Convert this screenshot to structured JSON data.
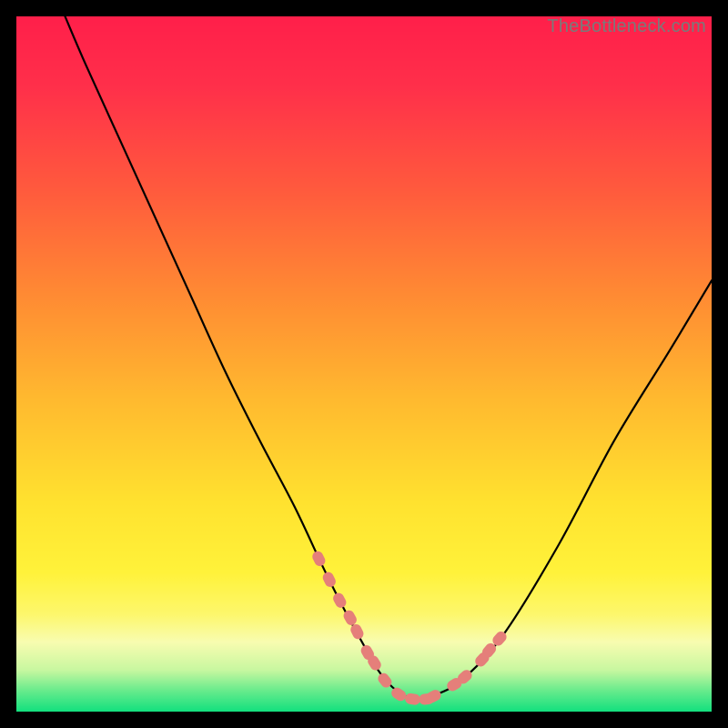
{
  "watermark": "TheBottleneck.com",
  "colors": {
    "frame": "#000000",
    "gradient_stops": [
      {
        "offset": 0.0,
        "color": "#ff1f4a"
      },
      {
        "offset": 0.1,
        "color": "#ff2f4a"
      },
      {
        "offset": 0.25,
        "color": "#ff5a3d"
      },
      {
        "offset": 0.4,
        "color": "#ff8a33"
      },
      {
        "offset": 0.55,
        "color": "#ffb92f"
      },
      {
        "offset": 0.7,
        "color": "#ffe22f"
      },
      {
        "offset": 0.8,
        "color": "#fff23a"
      },
      {
        "offset": 0.86,
        "color": "#fdf76c"
      },
      {
        "offset": 0.9,
        "color": "#f8fcb0"
      },
      {
        "offset": 0.94,
        "color": "#c8f7a0"
      },
      {
        "offset": 0.97,
        "color": "#67eb8c"
      },
      {
        "offset": 1.0,
        "color": "#12e07e"
      }
    ],
    "curve_stroke": "#000000",
    "marker": "#e57f7a"
  },
  "chart_data": {
    "type": "line",
    "title": "",
    "xlabel": "",
    "ylabel": "",
    "xlim": [
      0,
      100
    ],
    "ylim": [
      0,
      100
    ],
    "grid": false,
    "legend": false,
    "series": [
      {
        "name": "bottleneck-curve",
        "x": [
          7,
          10,
          15,
          20,
          25,
          30,
          35,
          40,
          44,
          47,
          50,
          52,
          54,
          56,
          58,
          60,
          64,
          70,
          78,
          86,
          94,
          100
        ],
        "y": [
          100,
          93,
          82,
          71,
          60,
          49,
          39,
          29.5,
          21,
          15,
          9.5,
          6,
          3.6,
          2.2,
          1.7,
          2.3,
          4.5,
          11,
          24,
          39,
          52,
          62
        ]
      }
    ],
    "markers": {
      "name": "curve-highlight-points",
      "shape": "pill",
      "approx_radius_px": 7,
      "x": [
        43.5,
        45.0,
        46.5,
        48.0,
        49.0,
        50.5,
        51.5,
        53.0,
        55.0,
        57.0,
        59.0,
        60.0,
        63.0,
        64.5,
        67.0,
        68.0,
        69.5
      ],
      "y": [
        22.0,
        19.0,
        16.0,
        13.5,
        11.5,
        8.5,
        7.0,
        4.5,
        2.5,
        1.8,
        1.8,
        2.2,
        3.9,
        5.0,
        7.5,
        8.8,
        10.5
      ]
    }
  }
}
